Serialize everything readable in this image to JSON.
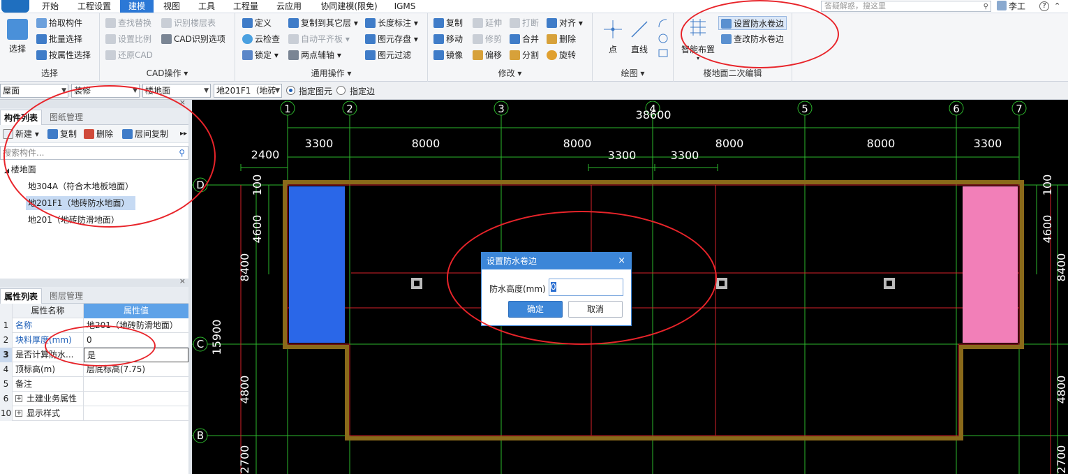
{
  "menu": {
    "tabs": [
      "开始",
      "工程设置",
      "建模",
      "视图",
      "工具",
      "工程量",
      "云应用",
      "协同建模(限免)",
      "IGMS"
    ],
    "active_tab": "建模",
    "search_placeholder": "答疑解惑，搜这里",
    "user_name": "李工"
  },
  "ribbon": {
    "select": {
      "big": "选择",
      "pick": "拾取构件",
      "batch": "批量选择",
      "by_attr": "按属性选择",
      "label": "选择"
    },
    "cad": {
      "find_replace": "查找替换",
      "set_scale": "设置比例",
      "restore_cad": "还原CAD",
      "identify_floor": "识别楼层表",
      "cad_options": "CAD识别选项",
      "label": "CAD操作 ▾"
    },
    "common": {
      "define": "定义",
      "cloud_check": "云检查",
      "lock": "锁定 ▾",
      "copy_to": "复制到其它层 ▾",
      "auto_flat": "自动平齐板 ▾",
      "two_point": "两点辅轴 ▾",
      "length_mark": "长度标注 ▾",
      "save_elem": "图元存盘 ▾",
      "filter": "图元过滤",
      "label": "通用操作 ▾"
    },
    "modify": {
      "copy": "复制",
      "move": "移动",
      "mirror": "镜像",
      "extend": "延伸",
      "trim": "修剪",
      "offset": "偏移",
      "break": "打断",
      "merge": "合并",
      "split": "分割",
      "align": "对齐 ▾",
      "delete": "删除",
      "rotate": "旋转",
      "label": "修改 ▾"
    },
    "draw": {
      "point": "点",
      "line": "直线",
      "label": "绘图 ▾"
    },
    "floor_edit": {
      "smart": "智能布置",
      "set_waterproof": "设置防水卷边",
      "view_waterproof": "查改防水卷边",
      "label": "楼地面二次编辑"
    }
  },
  "propbar": {
    "floor": "屋面",
    "category": "装修",
    "type": "楼地面",
    "element": "地201F1（地砖",
    "radio1": "指定图元",
    "radio2": "指定边"
  },
  "component_panel": {
    "tab1": "构件列表",
    "tab2": "图纸管理",
    "new": "新建 ▾",
    "copy": "复制",
    "delete": "删除",
    "floor_copy": "层间复制",
    "search_placeholder": "搜索构件...",
    "root": "楼地面",
    "items": [
      "地304A（符合木地板地面）",
      "地201F1（地砖防水地面）",
      "地201（地砖防滑地面）"
    ]
  },
  "property_panel": {
    "tab1": "属性列表",
    "tab2": "图层管理",
    "col_name": "属性名称",
    "col_value": "属性值",
    "rows": [
      {
        "num": "1",
        "name": "名称",
        "value": "地201（地砖防滑地面）"
      },
      {
        "num": "2",
        "name": "块料厚度(mm)",
        "value": "0"
      },
      {
        "num": "3",
        "name": "是否计算防水...",
        "value": "是"
      },
      {
        "num": "4",
        "name": "顶标高(m)",
        "value": "层底标高(7.75)"
      },
      {
        "num": "5",
        "name": "备注",
        "value": ""
      },
      {
        "num": "6",
        "name": "土建业务属性",
        "value": ""
      },
      {
        "num": "10",
        "name": "显示样式",
        "value": ""
      }
    ]
  },
  "drawing": {
    "axes": [
      "1",
      "2",
      "3",
      "4",
      "5",
      "6",
      "7"
    ],
    "rows": [
      "D",
      "C",
      "B"
    ],
    "total": "38600",
    "spans": [
      "3300",
      "8000",
      "8000",
      "8000",
      "8000",
      "3300"
    ],
    "sub_spans": [
      "3300",
      "3300"
    ],
    "left_offset": "2400",
    "left_dims": [
      "100",
      "4600",
      "8400",
      "15900",
      "4800",
      "2700"
    ],
    "right_dims": [
      "100",
      "4600",
      "8400",
      "4800",
      "2700"
    ]
  },
  "dialog": {
    "title": "设置防水卷边",
    "label": "防水高度(mm)",
    "value": "0",
    "ok": "确定",
    "cancel": "取消"
  }
}
